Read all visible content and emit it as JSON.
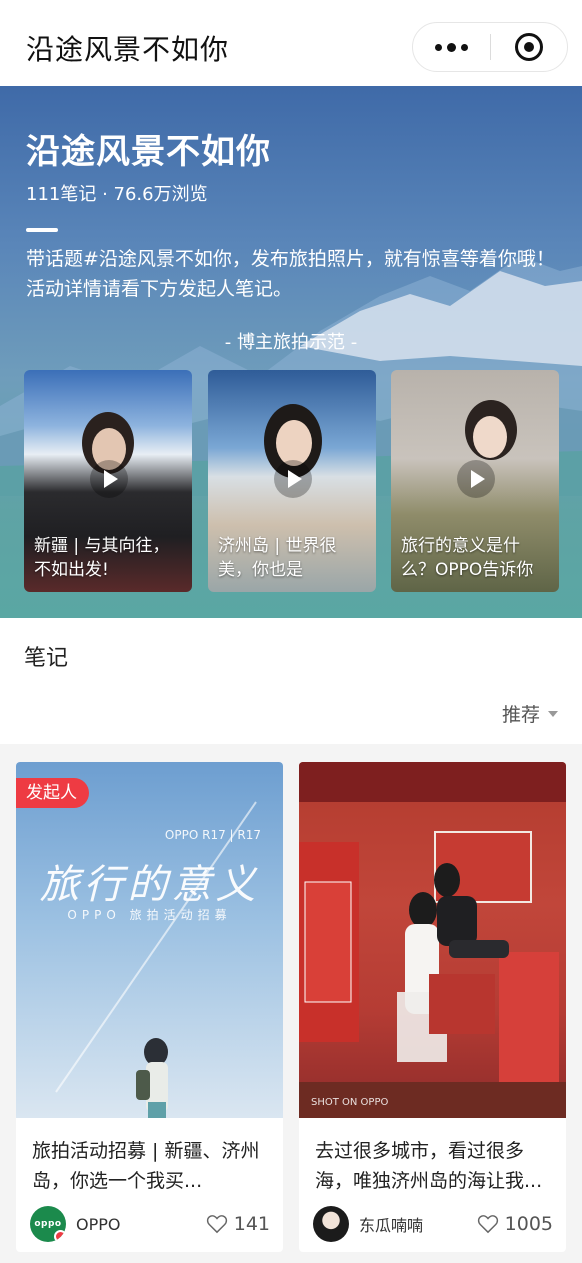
{
  "nav": {
    "title": "沿途风景不如你"
  },
  "hero": {
    "title": "沿途风景不如你",
    "stats": "111笔记 · 76.6万浏览",
    "description": "带话题#沿途风景不如你，发布旅拍照片，就有惊喜等着你哦！活动详情请看下方发起人笔记。",
    "section_label": "- 博主旅拍示范 -",
    "demo_videos": [
      {
        "caption": "新疆 | 与其向往，不如出发!"
      },
      {
        "caption": "济州岛 | 世界很美，你也是"
      },
      {
        "caption": "旅行的意义是什么？OPPO告诉你"
      }
    ]
  },
  "notes": {
    "title": "笔记",
    "sort_label": "推荐",
    "cards": [
      {
        "badge": "发起人",
        "poster_sub": "OPPO R17 | R17",
        "poster_title": "旅行的意义",
        "poster_title2": "OPPO 旅拍活动招募",
        "text": "旅拍活动招募 | 新疆、济州岛，你选一个我买...",
        "author": "OPPO",
        "avatar_text": "oppo",
        "likes": "141"
      },
      {
        "shot_on": "SHOT ON OPPO",
        "text": "去过很多城市，看过很多海，唯独济州岛的海让我...",
        "author": "东瓜喃喃",
        "likes": "1005"
      }
    ]
  },
  "colors": {
    "accent_red": "#ee3b43",
    "hero_blue": "#4f79b0",
    "hero_teal": "#5aa7a3"
  }
}
